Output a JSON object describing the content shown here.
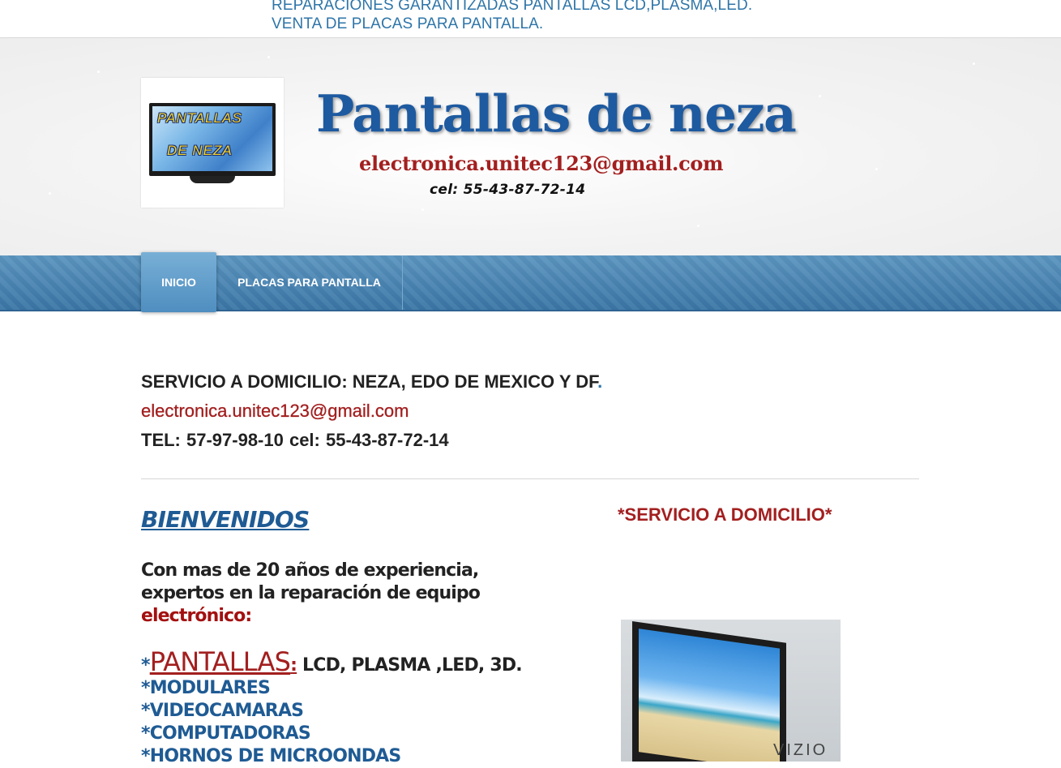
{
  "top_strip": {
    "line1": "REPARACIONES GARANTIZADAS PANTALLAS LCD,PLASMA,LED.",
    "line2": "VENTA DE PLACAS PARA PANTALLA."
  },
  "header": {
    "logo_line1": "PANTALLAS",
    "logo_line2": "DE NEZA",
    "title": "Pantallas de neza",
    "email": "electronica.unitec123@gmail.com",
    "cel": "cel: 55-43-87-72-14"
  },
  "nav": {
    "items": [
      {
        "label": "INICIO",
        "active": true
      },
      {
        "label": "PLACAS PARA PANTALLA",
        "active": false
      }
    ]
  },
  "contact": {
    "service": "SERVICIO A DOMICILIO: NEZA, EDO DE MEXICO Y DF",
    "service_dot": ".",
    "email": "electronica.unitec123@gmail.com",
    "tel": "TEL: 57-97-98-10   cel: 55-43-87-72-14"
  },
  "main": {
    "welcome": "BIENVENIDOS",
    "intro_line1": "Con mas de 20 años de experiencia,",
    "intro_line2": "expertos en la reparación de equipo",
    "intro_line3": "electrónico:",
    "list": {
      "star": "*",
      "pantallas": "PANTALLAS",
      "colon": ":",
      "pantallas_types": " LCD, PLASMA ,LED, 3D.",
      "items": [
        "*MODULARES",
        "*VIDEOCAMARAS",
        "*COMPUTADORAS",
        "*HORNOS DE MICROONDAS"
      ]
    }
  },
  "sidebar": {
    "title": "*SERVICIO A DOMICILIO*",
    "tv_brand": "VIZIO"
  },
  "colors": {
    "brand_blue": "#1e5aa0",
    "accent_red": "#a31f1f",
    "nav_blue": "#4a86b5"
  }
}
